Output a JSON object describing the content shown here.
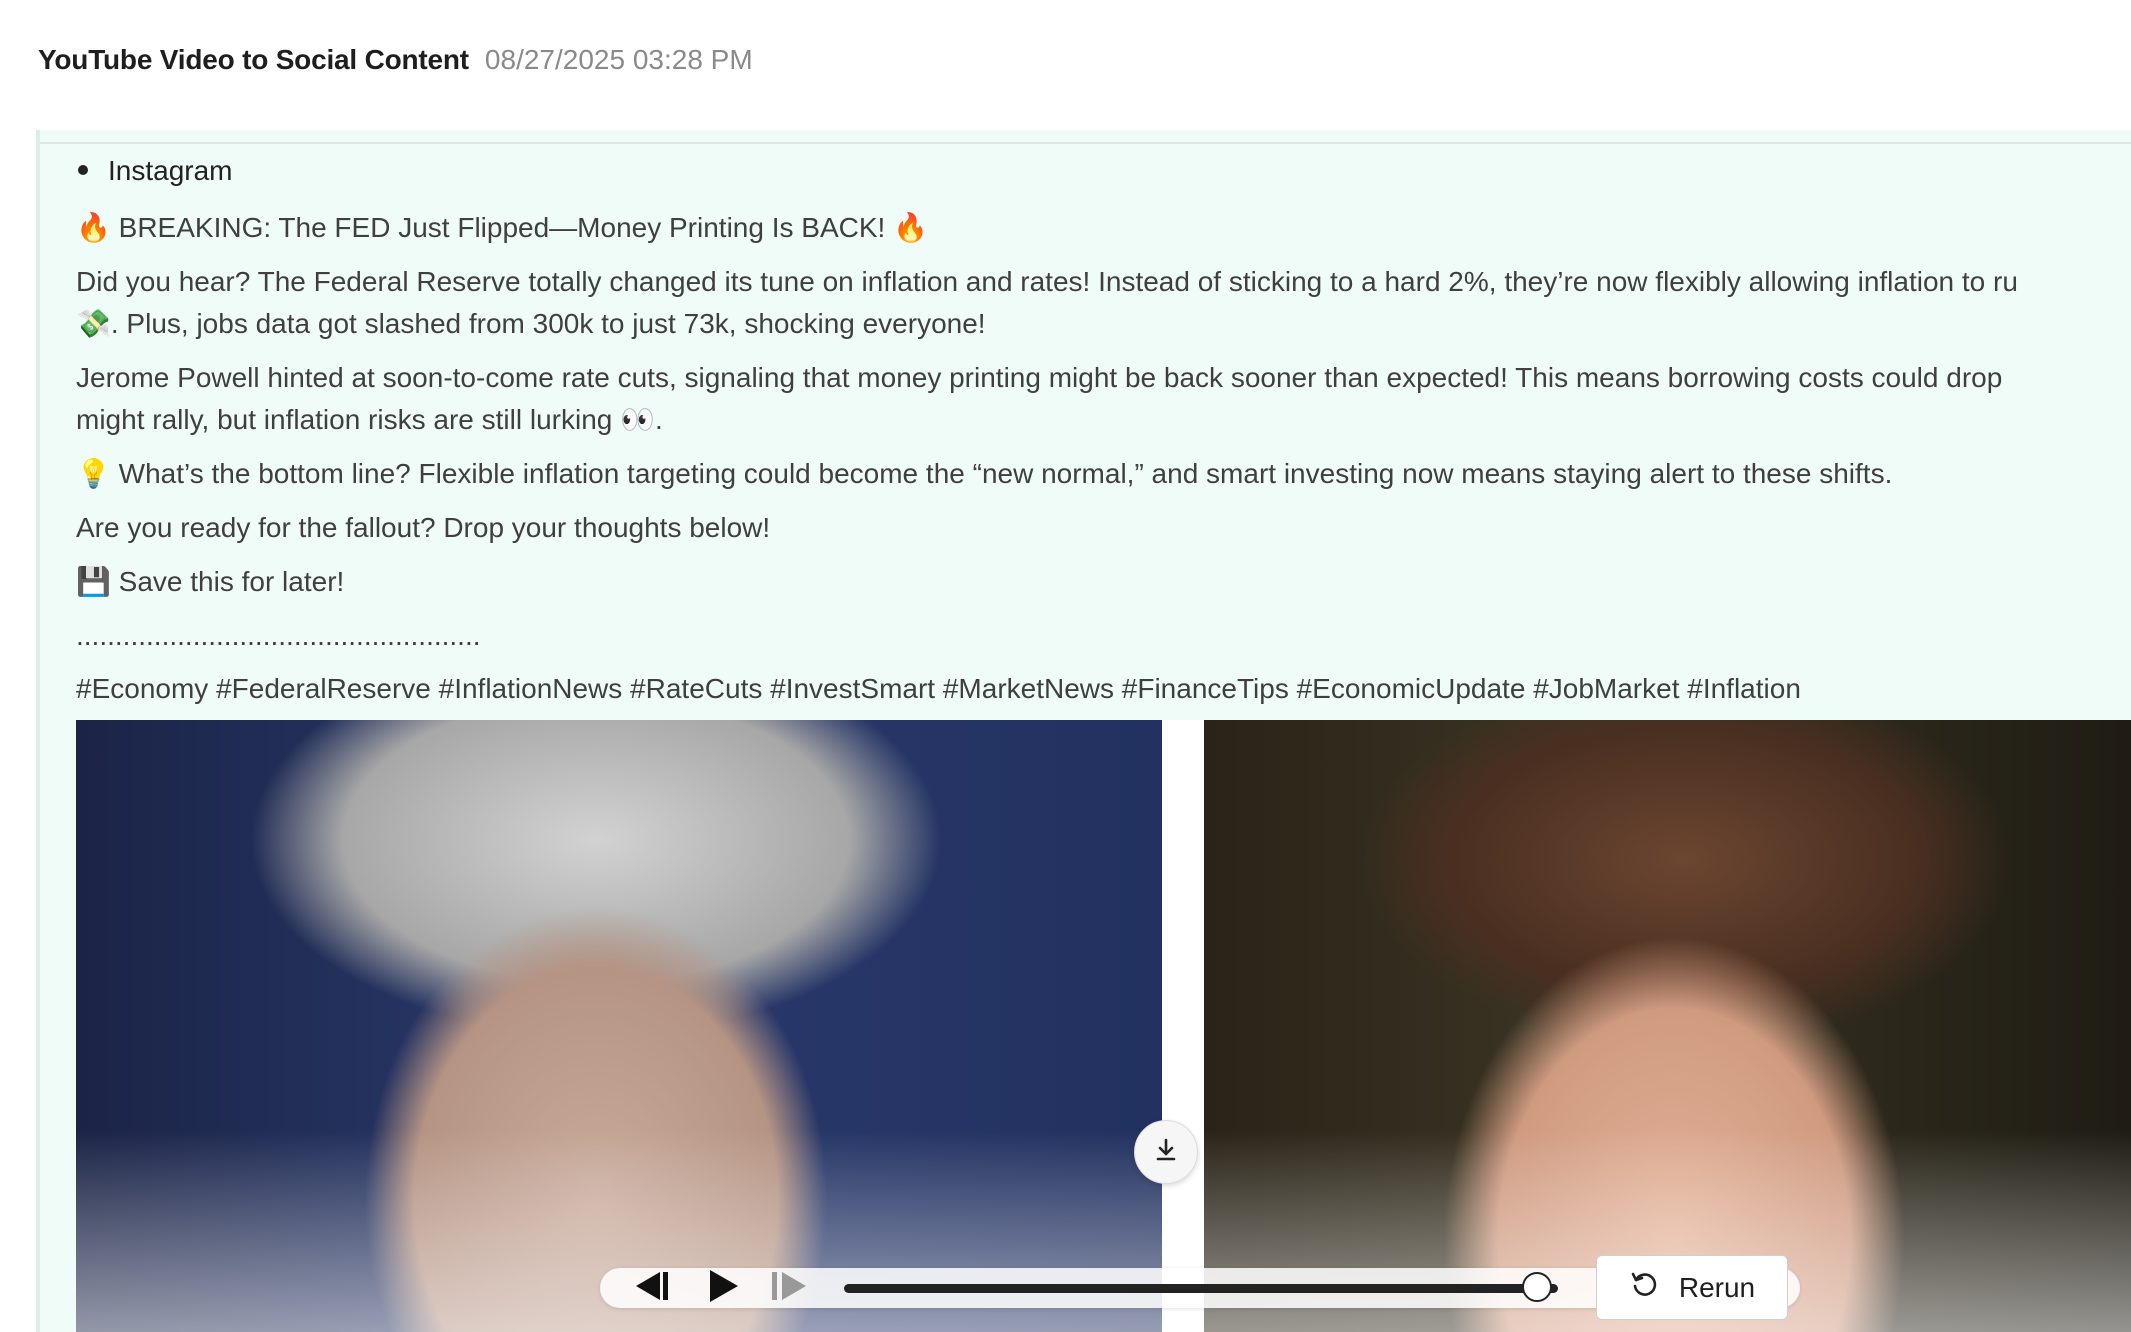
{
  "header": {
    "title": "YouTube Video to Social Content",
    "timestamp": "08/27/2025 03:28 PM"
  },
  "post": {
    "platform": "Instagram",
    "headline": "🔥 BREAKING: The FED Just Flipped—Money Printing Is BACK! 🔥",
    "p1_line1": "Did you hear? The Federal Reserve totally changed its tune on inflation and rates! Instead of sticking to a hard 2%, they’re now flexibly allowing inflation to ru",
    "p1_line2": "💸. Plus, jobs data got slashed from 300k to just 73k, shocking everyone!",
    "p2_line1": "Jerome Powell hinted at soon-to-come rate cuts, signaling that money printing might be back sooner than expected! This means borrowing costs could drop",
    "p2_line2": "might rally, but inflation risks are still lurking 👀.",
    "p3": "💡 What’s the bottom line? Flexible inflation targeting could become the “new normal,” and smart investing now means staying alert to these shifts.",
    "p4": "Are you ready for the fallout? Drop your thoughts below!",
    "p5": "💾 Save this for later!",
    "separator": "....................................................",
    "hashtags": "#Economy #FederalReserve #InflationNews #RateCuts #InvestSmart #MarketNews #FinanceTips #EconomicUpdate #JobMarket #Inflation"
  },
  "player": {
    "progress": 0.97
  },
  "actions": {
    "rerun_label": "Rerun"
  },
  "icons": {
    "download": "download-icon",
    "prev": "skip-back-icon",
    "play": "play-icon",
    "next": "skip-forward-icon",
    "rerun": "rerun-icon"
  }
}
